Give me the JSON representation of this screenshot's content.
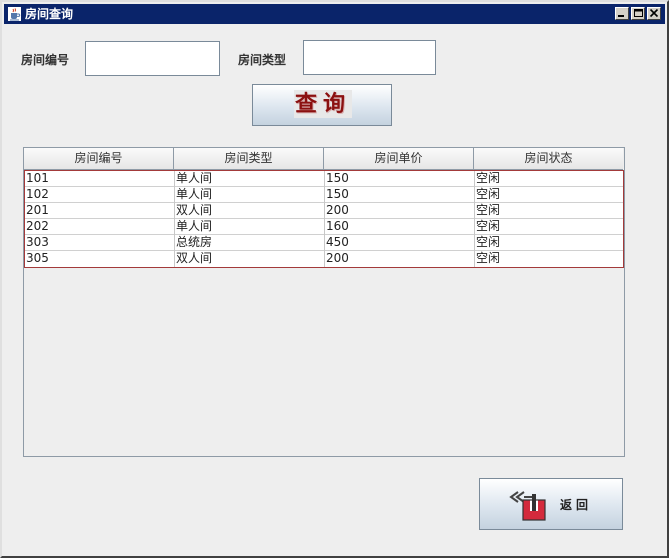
{
  "window": {
    "title": "房间查询",
    "controls": {
      "minimize_icon": "minimize-icon",
      "maximize_icon": "maximize-icon",
      "close_icon": "close-icon"
    }
  },
  "form": {
    "room_number_label": "房间编号",
    "room_number_value": "",
    "room_type_label": "房间类型",
    "room_type_value": ""
  },
  "query_button": {
    "label": "查询",
    "color": "#8b1010"
  },
  "table": {
    "columns": [
      "房间编号",
      "房间类型",
      "房间单价",
      "房间状态"
    ],
    "rows": [
      [
        "101",
        "单人间",
        "150",
        "空闲"
      ],
      [
        "102",
        "单人间",
        "150",
        "空闲"
      ],
      [
        "201",
        "双人间",
        "200",
        "空闲"
      ],
      [
        "202",
        "单人间",
        "160",
        "空闲"
      ],
      [
        "303",
        "总统房",
        "450",
        "空闲"
      ],
      [
        "305",
        "双人间",
        "200",
        "空闲"
      ]
    ],
    "selection_border_color": "#a33a3a"
  },
  "back_button": {
    "label": "返回",
    "icon": "back-arrow-icon",
    "icon_color": "#d42a3c"
  },
  "colors": {
    "titlebar": "#0a246a",
    "background": "#eeeeee"
  }
}
